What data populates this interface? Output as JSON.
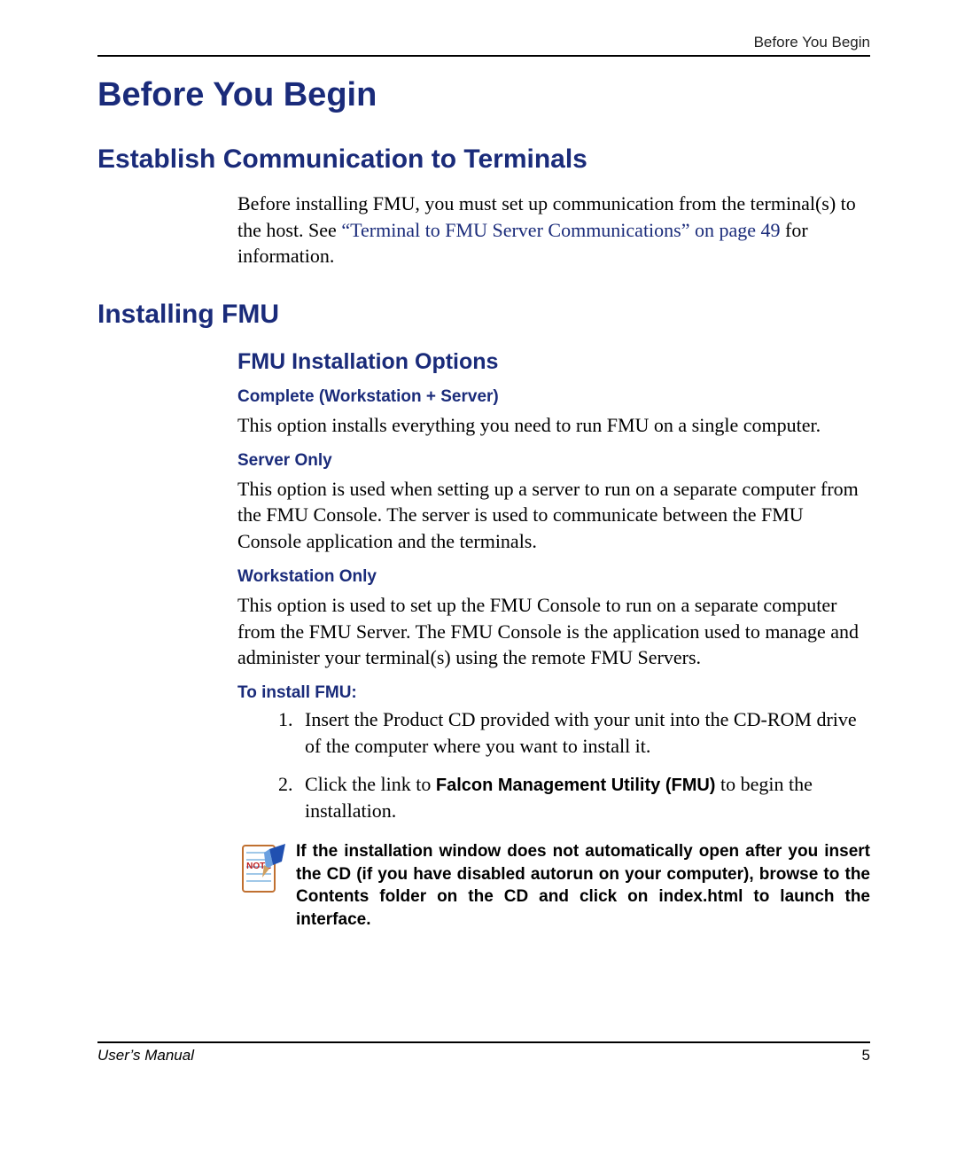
{
  "running_head": "Before You Begin",
  "title": "Before You Begin",
  "sections": {
    "establish": {
      "heading": "Establish Communication to Terminals",
      "para_a": "Before installing FMU, you must set up communication from the terminal(s) to the host. See ",
      "link": "“Terminal to FMU Server Communications” on page 49",
      "para_b": " for information."
    },
    "installing": {
      "heading": "Installing FMU",
      "sub": "FMU Installation Options",
      "options": {
        "complete": {
          "head": "Complete (Workstation + Server)",
          "text": "This option installs everything you need to run FMU on a single computer."
        },
        "server": {
          "head": "Server Only",
          "text": "This option is used when setting up a server to run on a separate computer from the FMU Console. The server is used to communicate between the FMU Console application and the terminals."
        },
        "workstation": {
          "head": "Workstation Only",
          "text": "This option is used to set up the FMU Console to run on a separate computer from the FMU Server. The FMU Console is the application used to manage and administer your terminal(s) using the remote FMU Servers."
        }
      },
      "install_head": "To install FMU:",
      "steps": {
        "s1": "Insert the Product CD provided with your unit into the CD-ROM drive of the computer where you want to install it.",
        "s2a": "Click the link to ",
        "s2b": "Falcon Management Utility (FMU)",
        "s2c": " to begin the installation."
      },
      "note_label": "NOTE",
      "note": "If the installation window does not automatically open after you insert the CD (if you have disabled autorun on your computer), browse to the Contents folder on the CD and click on index.html to launch the interface."
    }
  },
  "footer": {
    "manual": "User’s Manual",
    "page": "5"
  }
}
